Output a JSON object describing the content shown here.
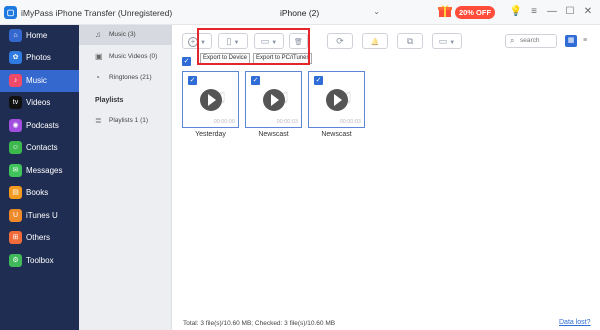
{
  "app": {
    "title": "iMyPass iPhone Transfer (Unregistered)",
    "logo_text": "▢"
  },
  "device": {
    "name": "iPhone (2)",
    "apple_glyph": "",
    "chevron": "⌄"
  },
  "promo": {
    "label": "20% OFF",
    "color": "#ff4d3a"
  },
  "window_controls": {
    "bulb": "💡",
    "menu": "≡",
    "minimize": "—",
    "maximize": "☐",
    "close": "✕"
  },
  "sidebar": {
    "items": [
      {
        "label": "Home",
        "icon": "home-icon",
        "glyph": "⌂",
        "color": "#3568cf"
      },
      {
        "label": "Photos",
        "icon": "photos-icon",
        "glyph": "✿",
        "color": "#2f7be0"
      },
      {
        "label": "Music",
        "icon": "music-icon",
        "glyph": "♪",
        "color": "#f04a6b"
      },
      {
        "label": "Videos",
        "icon": "videos-icon",
        "glyph": "tv",
        "color": "#111111"
      },
      {
        "label": "Podcasts",
        "icon": "podcasts-icon",
        "glyph": "◉",
        "color": "#a24fe0"
      },
      {
        "label": "Contacts",
        "icon": "contacts-icon",
        "glyph": "☺",
        "color": "#3db84d"
      },
      {
        "label": "Messages",
        "icon": "messages-icon",
        "glyph": "✉",
        "color": "#3fc35a"
      },
      {
        "label": "Books",
        "icon": "books-icon",
        "glyph": "▤",
        "color": "#f39a1f"
      },
      {
        "label": "iTunes U",
        "icon": "itunes-u-icon",
        "glyph": "U",
        "color": "#ef8a2a"
      },
      {
        "label": "Others",
        "icon": "others-icon",
        "glyph": "⊞",
        "color": "#f06a3a"
      },
      {
        "label": "Toolbox",
        "icon": "toolbox-icon",
        "glyph": "⚙",
        "color": "#3fb95a"
      }
    ]
  },
  "subpanel": {
    "items": [
      {
        "label": "Music (3)",
        "glyph": "♫"
      },
      {
        "label": "Music Videos (0)",
        "glyph": "▣"
      },
      {
        "label": "Ringtones (21)",
        "glyph": "◔"
      }
    ],
    "section": "Playlists",
    "playlist": {
      "label": "Playlists 1 (1)",
      "glyph": "≣"
    }
  },
  "toolbar": {
    "add_glyph": "+",
    "export_device_glyph": "▯",
    "export_pc_glyph": "▭",
    "delete_glyph": "🗑",
    "sync_glyph": "⟳",
    "notify_glyph": "🔔",
    "copy_glyph": "⧉",
    "more_glyph": "▭",
    "tooltip_device": "Export to Device",
    "tooltip_pc": "Export to PC/iTunes",
    "search_placeholder": "search",
    "grid_glyph": "▦",
    "list_glyph": "≡"
  },
  "check_glyph": "✓",
  "tracks": [
    {
      "name": "Yesterday",
      "duration": "00:00:00"
    },
    {
      "name": "Newscast",
      "duration": "00:00:03"
    },
    {
      "name": "Newscast",
      "duration": "00:00:03"
    }
  ],
  "status": {
    "text": "Total: 3 file(s)/10.60 MB; Checked: 3 file(s)/10.60 MB",
    "data_lost": "Data lost?"
  },
  "colors": {
    "accent": "#3568cf",
    "sidebar_bg": "#1f2d52",
    "highlight": "#e3262b"
  }
}
